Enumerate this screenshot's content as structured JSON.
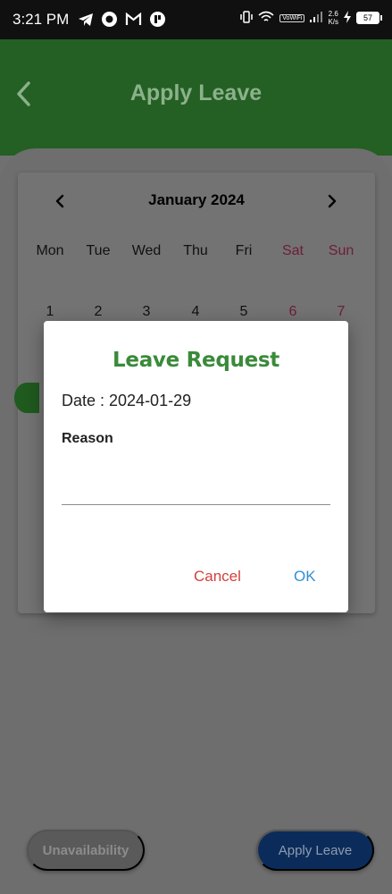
{
  "status_bar": {
    "time": "3:21 PM",
    "icons": [
      "telegram-icon",
      "record-icon",
      "gmail-icon",
      "app-icon"
    ],
    "vowifi": "VoWiFi",
    "speed_value": "2.6",
    "speed_unit": "K/s",
    "battery": "57"
  },
  "header": {
    "title": "Apply Leave",
    "back_icon": "chevron-left-icon"
  },
  "calendar": {
    "month": "January 2024",
    "prev_icon": "chevron-left-icon",
    "next_icon": "chevron-right-icon",
    "weekdays": [
      "Mon",
      "Tue",
      "Wed",
      "Thu",
      "Fri",
      "Sat",
      "Sun"
    ],
    "first_row": [
      "1",
      "2",
      "3",
      "4",
      "5",
      "6",
      "7"
    ]
  },
  "dialog": {
    "title": "Leave Request",
    "date": "Date : 2024-01-29",
    "reason_label": "Reason",
    "reason_value": "",
    "cancel": "Cancel",
    "ok": "OK"
  },
  "buttons": {
    "unavailability": "Unavailability",
    "apply_leave": "Apply Leave"
  },
  "colors": {
    "header_green": "#245f24",
    "title_green": "#3a8a3a",
    "cancel_red": "#d0413c",
    "ok_blue": "#2f8fd6",
    "apply_navy": "#0b2c5a"
  }
}
